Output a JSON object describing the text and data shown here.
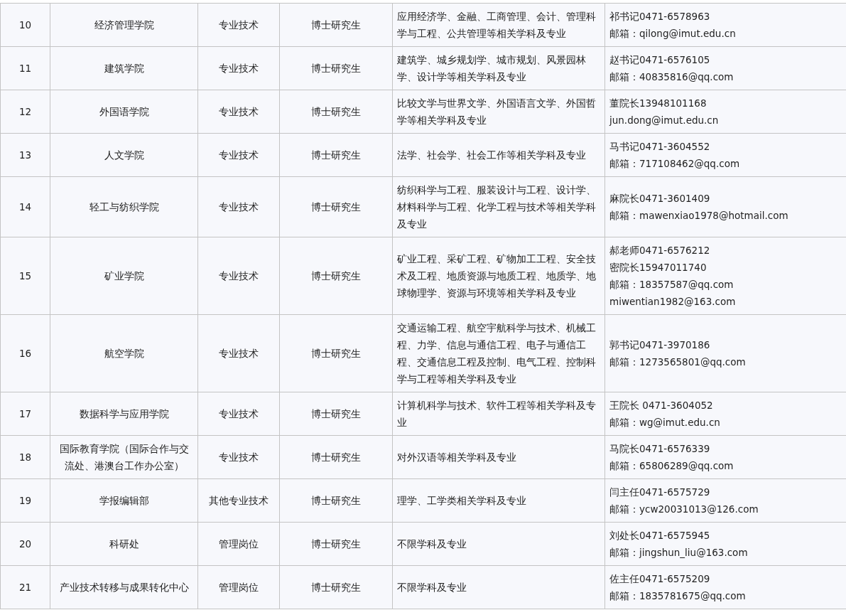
{
  "table": {
    "rows": [
      {
        "number": "10",
        "department": "经济管理学院",
        "post_type": "专业技术",
        "degree": "博士研究生",
        "subjects": "应用经济学、金融、工商管理、会计、管理科学与工程、公共管理等相关学科及专业",
        "contacts": [
          "祁书记0471-6578963",
          "邮箱：qilong@imut.edu.cn"
        ]
      },
      {
        "number": "11",
        "department": "建筑学院",
        "post_type": "专业技术",
        "degree": "博士研究生",
        "subjects": "建筑学、城乡规划学、城市规划、风景园林学、设计学等相关学科及专业",
        "contacts": [
          "赵书记0471-6576105",
          "邮箱：40835816@qq.com"
        ]
      },
      {
        "number": "12",
        "department": "外国语学院",
        "post_type": "专业技术",
        "degree": "博士研究生",
        "subjects": "比较文学与世界文学、外国语言文学、外国哲学等相关学科及专业",
        "contacts": [
          "董院长13948101168",
          "jun.dong@imut.edu.cn"
        ]
      },
      {
        "number": "13",
        "department": "人文学院",
        "post_type": "专业技术",
        "degree": "博士研究生",
        "subjects": "法学、社会学、社会工作等相关学科及专业",
        "contacts": [
          "马书记0471-3604552",
          "邮箱：717108462@qq.com"
        ]
      },
      {
        "number": "14",
        "department": "轻工与纺织学院",
        "post_type": "专业技术",
        "degree": "博士研究生",
        "subjects": "纺织科学与工程、服装设计与工程、设计学、材料科学与工程、化学工程与技术等相关学科及专业",
        "contacts": [
          "麻院长0471-3601409",
          "邮箱：mawenxiao1978@hotmail.com"
        ]
      },
      {
        "number": "15",
        "department": "矿业学院",
        "post_type": "专业技术",
        "degree": "博士研究生",
        "subjects": "矿业工程、采矿工程、矿物加工工程、安全技术及工程、地质资源与地质工程、地质学、地球物理学、资源与环境等相关学科及专业",
        "contacts": [
          "郝老师0471-6576212",
          "密院长15947011740",
          "邮箱：18357587@qq.com",
          "miwentian1982@163.com"
        ]
      },
      {
        "number": "16",
        "department": "航空学院",
        "post_type": "专业技术",
        "degree": "博士研究生",
        "subjects": "交通运输工程、航空宇航科学与技术、机械工程、力学、信息与通信工程、电子与通信工程、交通信息工程及控制、电气工程、控制科学与工程等相关学科及专业",
        "contacts": [
          "郭书记0471-3970186",
          "邮箱：1273565801@qq.com"
        ]
      },
      {
        "number": "17",
        "department": "数据科学与应用学院",
        "post_type": "专业技术",
        "degree": "博士研究生",
        "subjects": "计算机科学与技术、软件工程等相关学科及专业",
        "contacts": [
          "王院长 0471-3604052",
          "邮箱：wg@imut.edu.cn"
        ]
      },
      {
        "number": "18",
        "department": "国际教育学院（国际合作与交流处、港澳台工作办公室）",
        "post_type": "专业技术",
        "degree": "博士研究生",
        "subjects": "对外汉语等相关学科及专业",
        "contacts": [
          "马院长0471-6576339",
          "邮箱：65806289@qq.com"
        ]
      },
      {
        "number": "19",
        "department": "学报编辑部",
        "post_type": "其他专业技术",
        "degree": "博士研究生",
        "subjects": "理学、工学类相关学科及专业",
        "contacts": [
          "闫主任0471-6575729",
          "邮箱：ycw20031013@126.com"
        ]
      },
      {
        "number": "20",
        "department": "科研处",
        "post_type": "管理岗位",
        "degree": "博士研究生",
        "subjects": "不限学科及专业",
        "contacts": [
          "刘处长0471-6575945",
          "邮箱：jingshun_liu@163.com"
        ]
      },
      {
        "number": "21",
        "department": "产业技术转移与成果转化中心",
        "post_type": "管理岗位",
        "degree": "博士研究生",
        "subjects": "不限学科及专业",
        "contacts": [
          "佐主任0471-6575209",
          "邮箱：1835781675@qq.com"
        ]
      }
    ]
  }
}
